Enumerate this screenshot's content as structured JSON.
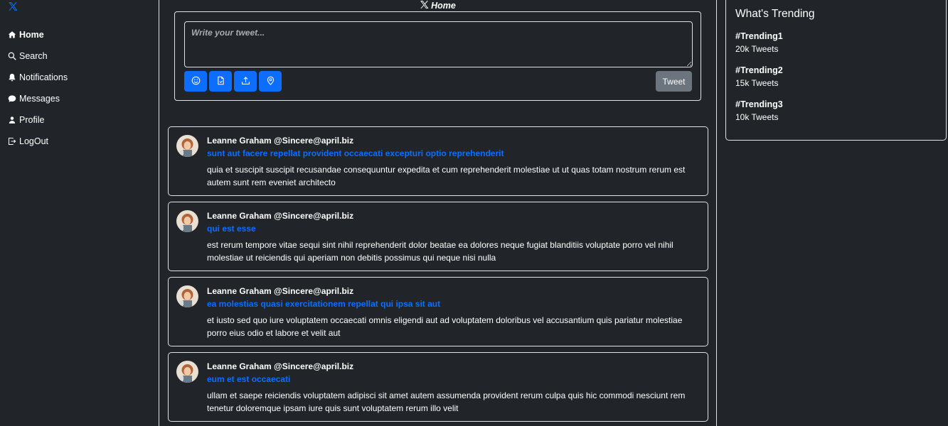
{
  "sidebar": {
    "logo_icon": "x-logo-icon",
    "items": [
      {
        "label": "Home",
        "icon": "home-icon",
        "active": true
      },
      {
        "label": "Search",
        "icon": "search-icon"
      },
      {
        "label": "Notifications",
        "icon": "bell-icon"
      },
      {
        "label": "Messages",
        "icon": "chat-icon"
      },
      {
        "label": "Profile",
        "icon": "person-icon"
      },
      {
        "label": "LogOut",
        "icon": "logout-icon"
      }
    ]
  },
  "header": {
    "title": "Home",
    "icon": "x-logo-icon"
  },
  "composer": {
    "placeholder": "Write your tweet...",
    "value": "",
    "tools": [
      "emoji-icon",
      "file-icon",
      "upload-icon",
      "location-icon"
    ],
    "tweet_label": "Tweet"
  },
  "feed": {
    "tweets": [
      {
        "user": "Leanne Graham @Sincere@april.biz",
        "title": "sunt aut facere repellat provident occaecati excepturi optio reprehenderit",
        "body": "quia et suscipit suscipit recusandae consequuntur expedita et cum reprehenderit molestiae ut ut quas totam nostrum rerum est autem sunt rem eveniet architecto"
      },
      {
        "user": "Leanne Graham @Sincere@april.biz",
        "title": "qui est esse",
        "body": "est rerum tempore vitae sequi sint nihil reprehenderit dolor beatae ea dolores neque fugiat blanditiis voluptate porro vel nihil molestiae ut reiciendis qui aperiam non debitis possimus qui neque nisi nulla"
      },
      {
        "user": "Leanne Graham @Sincere@april.biz",
        "title": "ea molestias quasi exercitationem repellat qui ipsa sit aut",
        "body": "et iusto sed quo iure voluptatem occaecati omnis eligendi aut ad voluptatem doloribus vel accusantium quis pariatur molestiae porro eius odio et labore et velit aut"
      },
      {
        "user": "Leanne Graham @Sincere@april.biz",
        "title": "eum et est occaecati",
        "body": "ullam et saepe reiciendis voluptatem adipisci sit amet autem assumenda provident rerum culpa quis hic commodi nesciunt rem tenetur doloremque ipsam iure quis sunt voluptatem rerum illo velit"
      }
    ]
  },
  "trending": {
    "title": "What's Trending",
    "items": [
      {
        "tag": "#Trending1",
        "count": "20k Tweets"
      },
      {
        "tag": "#Trending2",
        "count": "15k Tweets"
      },
      {
        "tag": "#Trending3",
        "count": "10k Tweets"
      }
    ]
  },
  "colors": {
    "background": "#212529",
    "accent": "#0d6efd",
    "border": "#dee2e6",
    "secondary_button": "#6c757d"
  }
}
